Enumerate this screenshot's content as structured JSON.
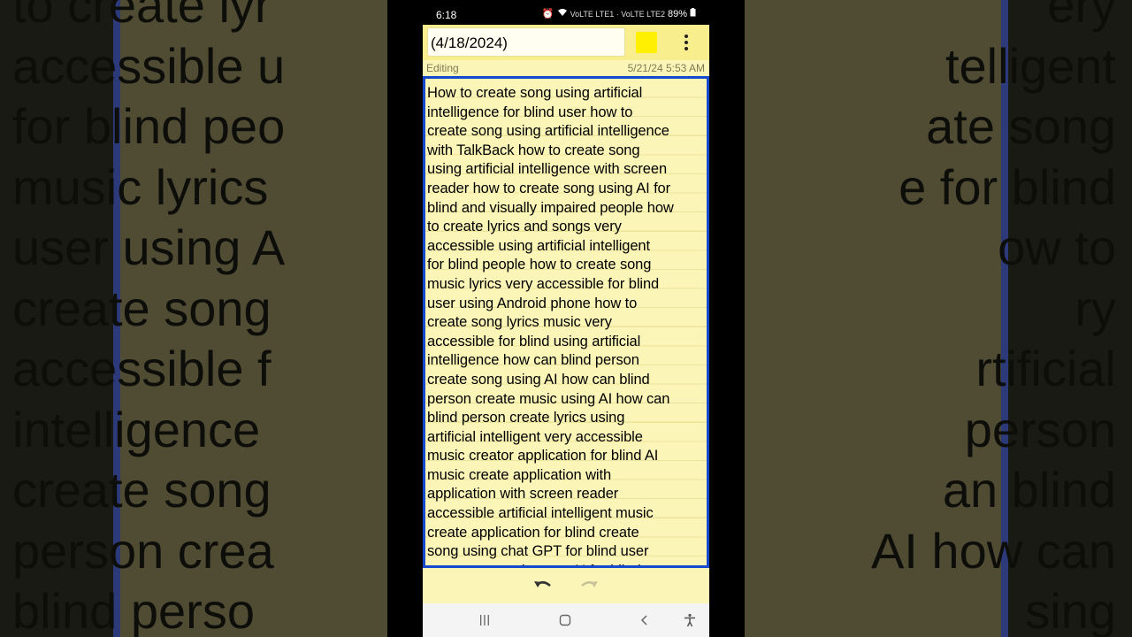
{
  "status_bar": {
    "time": "6:18",
    "battery": "89%",
    "signal_label": "VoLTE LTE1 · VoLTE LTE2"
  },
  "note": {
    "title": "(4/18/2024)",
    "mode": "Editing",
    "timestamp": "5/21/24 5:53 AM",
    "color": "#ffef00",
    "body_lines": [
      "How to create song using artificial",
      "intelligence for blind user how to",
      "create song using artificial intelligence",
      "with TalkBack how to create song",
      "using artificial intelligence with screen",
      "reader how to create song using AI for",
      "blind and visually impaired people how",
      "to create lyrics and songs very",
      "accessible using artificial intelligent",
      "for blind people how to create song",
      "music lyrics very accessible for blind",
      "user using Android phone how to",
      "create song lyrics music very",
      "accessible for blind using artificial",
      "intelligence how can blind person",
      "create song using AI how can blind",
      "person create music using AI how can",
      "blind person create lyrics using",
      "artificial intelligent very accessible",
      "music creator application for blind AI",
      "music create application with",
      "application with screen reader",
      "accessible artificial intelligent music",
      "create application for blind create",
      "song using chat GPT for blind user",
      "create song using app AI for blind"
    ]
  },
  "background": {
    "left_lines": [
      "to create lyr",
      "accessible u",
      "for blind peo",
      "music lyrics",
      "user using A",
      "create song",
      "accessible f",
      "intelligence",
      "create song",
      "person crea",
      "blind perso"
    ],
    "right_lines": [
      "ery",
      "telligent",
      "ate song",
      "e for blind",
      "ow to",
      "ry",
      "rtificial",
      "person",
      "an blind",
      "AI how can",
      "sing"
    ]
  }
}
